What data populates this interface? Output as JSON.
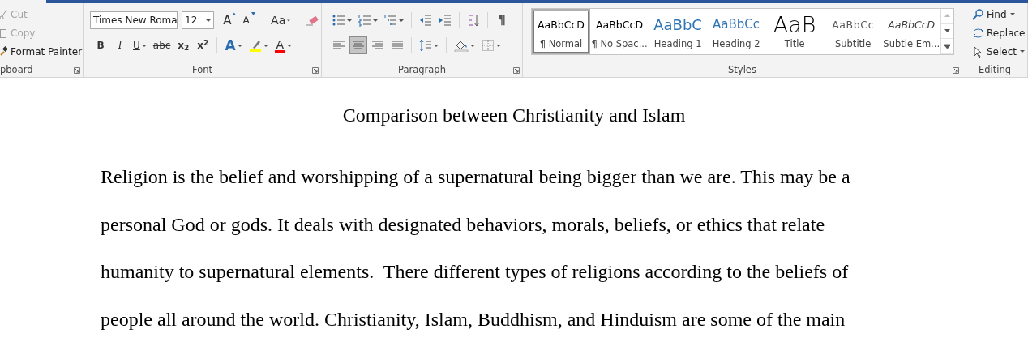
{
  "ribbon": {
    "clipboard": {
      "items": [
        {
          "label": "Cut",
          "disabled": true
        },
        {
          "label": "Copy",
          "disabled": true
        },
        {
          "label": "Format Painter",
          "disabled": false
        }
      ],
      "group_label": "pboard"
    },
    "font": {
      "font_name": "Times New Roma",
      "font_size": "12",
      "grow_label": "A",
      "shrink_label": "A",
      "case_label": "Aa",
      "style_buttons": [
        {
          "label": "B"
        },
        {
          "label": "I"
        },
        {
          "label": "U"
        },
        {
          "label": "abc"
        },
        {
          "label": "x$_{2}$"
        },
        {
          "label": "x$^{2}$"
        }
      ],
      "effects_label": "A",
      "color_label": "A",
      "group_label": "Font"
    },
    "paragraph": {
      "pilcrow": "¶",
      "align_buttons": [
        {
          "selected": false
        },
        {
          "selected": true
        },
        {
          "selected": false
        },
        {
          "selected": false
        }
      ],
      "group_label": "Paragraph"
    },
    "styles": {
      "items": [
        {
          "preview": "AaBbCcD",
          "name": "¶ Normal",
          "kind": "body",
          "selected": true
        },
        {
          "preview": "AaBbCcD",
          "name": "¶ No Spac...",
          "kind": "body",
          "selected": false
        },
        {
          "preview": "AaBbC",
          "name": "Heading 1",
          "kind": "heading1",
          "selected": false
        },
        {
          "preview": "AaBbCc",
          "name": "Heading 2",
          "kind": "heading2",
          "selected": false
        },
        {
          "preview": "AaB",
          "name": "Title",
          "kind": "title",
          "selected": false
        },
        {
          "preview": "AaBbCc",
          "name": "Subtitle",
          "kind": "subtitle",
          "selected": false
        },
        {
          "preview": "AaBbCcD",
          "name": "Subtle Em...",
          "kind": "emphasis",
          "selected": false
        }
      ],
      "group_label": "Styles"
    },
    "editing": {
      "items": [
        {
          "label": "Find",
          "dropdown": true
        },
        {
          "label": "Replace",
          "dropdown": false
        },
        {
          "label": "Select",
          "dropdown": true
        }
      ],
      "group_label": "Editing"
    }
  },
  "document": {
    "title": "Comparison between Christianity and Islam",
    "lines": [
      "Religion is the belief and worshipping of a supernatural being bigger than we are. This may be a",
      "personal God or gods. It deals with designated behaviors, morals, beliefs, or ethics that relate",
      "humanity to supernatural elements.  There different types of religions according to the beliefs of",
      "people all around the world. Christianity, Islam, Buddhism, and Hinduism are some of the main"
    ]
  }
}
